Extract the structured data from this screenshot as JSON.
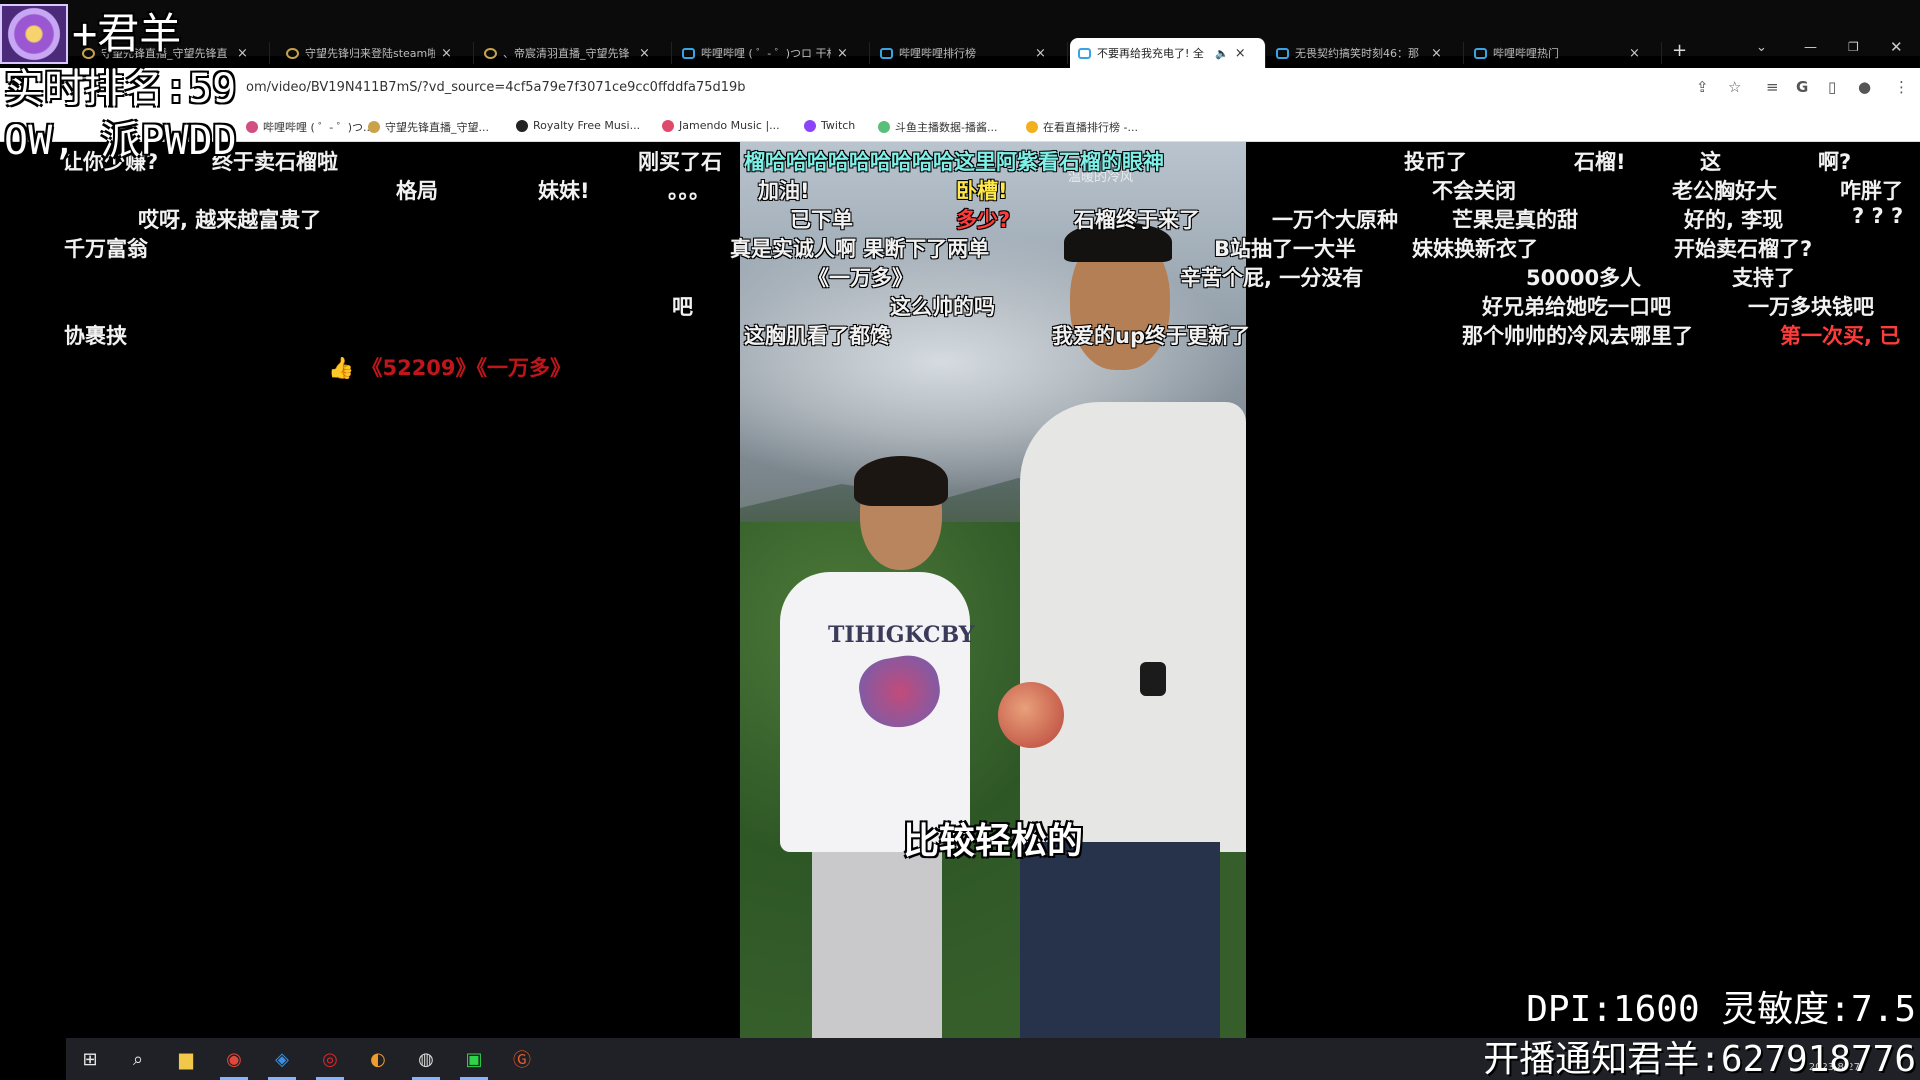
{
  "browser": {
    "tabs": [
      {
        "title": "守望先锋直播_守望先锋直",
        "icon": "overwatch-icon"
      },
      {
        "title": "守望先锋归来登陆steam啦",
        "icon": "overwatch-icon"
      },
      {
        "title": "、帝宸清羽直播_守望先锋",
        "icon": "overwatch-icon"
      },
      {
        "title": "哔哩哔哩 ( ゜- ゜)つロ 干杯",
        "icon": "bilibili-icon"
      },
      {
        "title": "哔哩哔哩排行榜",
        "icon": "bilibili-icon"
      },
      {
        "title": "不要再给我充电了! 全",
        "icon": "bilibili-icon",
        "active": true
      },
      {
        "title": "无畏契约搞笑时刻46：那",
        "icon": "bilibili-icon"
      },
      {
        "title": "哔哩哔哩热门",
        "icon": "bilibili-icon"
      }
    ],
    "new_tab": "+",
    "url": "om/video/BV19N411B7mS/?vd_source=4cf5a79e7f3071ce9cc0ffddfa75d19b",
    "bookmarks": [
      {
        "label": "哔哩哔哩 ( ゜- ゜)つ..."
      },
      {
        "label": "守望先锋直播_守望..."
      },
      {
        "label": "Royalty Free Musi..."
      },
      {
        "label": "Jamendo Music |..."
      },
      {
        "label": "Twitch"
      },
      {
        "label": "斗鱼主播数据-播酱..."
      },
      {
        "label": "在看直播排行榜 -..."
      }
    ]
  },
  "overlay": {
    "line1": "+君羊",
    "line2": "实时排名:59",
    "line3": "OW, 派PWDD",
    "dpi": "DPI:1600 灵敏度:7.5",
    "notify": "开播通知君羊:627918776"
  },
  "video": {
    "subtitle": "比较轻松的",
    "watermark": "温暖的冷风",
    "shirt_print": "TIHIGKCBY"
  },
  "danmaku": [
    {
      "text": "让你少赚?",
      "color": "white"
    },
    {
      "text": "终于卖石榴啦",
      "color": "white"
    },
    {
      "text": "刚买了石",
      "color": "white"
    },
    {
      "text": "格局",
      "color": "white"
    },
    {
      "text": "妹妹!",
      "color": "white"
    },
    {
      "text": "。。。",
      "color": "white"
    },
    {
      "text": "哎呀, 越来越富贵了",
      "color": "white"
    },
    {
      "text": "千万富翁",
      "color": "white"
    },
    {
      "text": "吧",
      "color": "white"
    },
    {
      "text": "协裹挟",
      "color": "white"
    },
    {
      "text": "《52209》《一万多》",
      "color": "darkred"
    },
    {
      "text": "榴哈哈哈哈哈哈哈哈哈这里阿紫看石榴的眼神",
      "color": "cyan"
    },
    {
      "text": "加油!",
      "color": "white"
    },
    {
      "text": "卧槽!",
      "color": "yellow"
    },
    {
      "text": "已下单",
      "color": "white"
    },
    {
      "text": "多少?",
      "color": "red"
    },
    {
      "text": "石榴终于来了",
      "color": "white"
    },
    {
      "text": "真是实诚人啊 果断下了两单",
      "color": "white"
    },
    {
      "text": "《一万多》",
      "color": "white"
    },
    {
      "text": "这么帅的吗",
      "color": "white"
    },
    {
      "text": "这胸肌看了都馋",
      "color": "white"
    },
    {
      "text": "我爱的up终于更新了",
      "color": "white"
    },
    {
      "text": "投币了",
      "color": "white"
    },
    {
      "text": "石榴!",
      "color": "white"
    },
    {
      "text": "这",
      "color": "white"
    },
    {
      "text": "啊?",
      "color": "white"
    },
    {
      "text": "不会关闭",
      "color": "white"
    },
    {
      "text": "老公胸好大",
      "color": "white"
    },
    {
      "text": "咋胖了",
      "color": "white"
    },
    {
      "text": "一万个大原种",
      "color": "white"
    },
    {
      "text": "芒果是真的甜",
      "color": "white"
    },
    {
      "text": "好的, 李现",
      "color": "white"
    },
    {
      "text": "? ? ?",
      "color": "white"
    },
    {
      "text": "B站抽了一大半",
      "color": "white"
    },
    {
      "text": "妹妹换新衣了",
      "color": "white"
    },
    {
      "text": "开始卖石榴了?",
      "color": "white"
    },
    {
      "text": "辛苦个屁, 一分没有",
      "color": "white"
    },
    {
      "text": "50000多人",
      "color": "white"
    },
    {
      "text": "支持了",
      "color": "white"
    },
    {
      "text": "好兄弟给她吃一口吧",
      "color": "white"
    },
    {
      "text": "一万多块钱吧",
      "color": "white"
    },
    {
      "text": "那个帅帅的冷风去哪里了",
      "color": "white"
    },
    {
      "text": "第一次买, 已",
      "color": "red"
    }
  ],
  "taskbar": {
    "date": "2023/8/27",
    "apps": [
      "windows-start-icon",
      "search-icon",
      "file-explorer-icon",
      "chrome-icon",
      "app-icon",
      "netease-music-icon",
      "overwatch-icon",
      "obs-icon",
      "iqiyi-icon",
      "g-app-icon"
    ]
  }
}
